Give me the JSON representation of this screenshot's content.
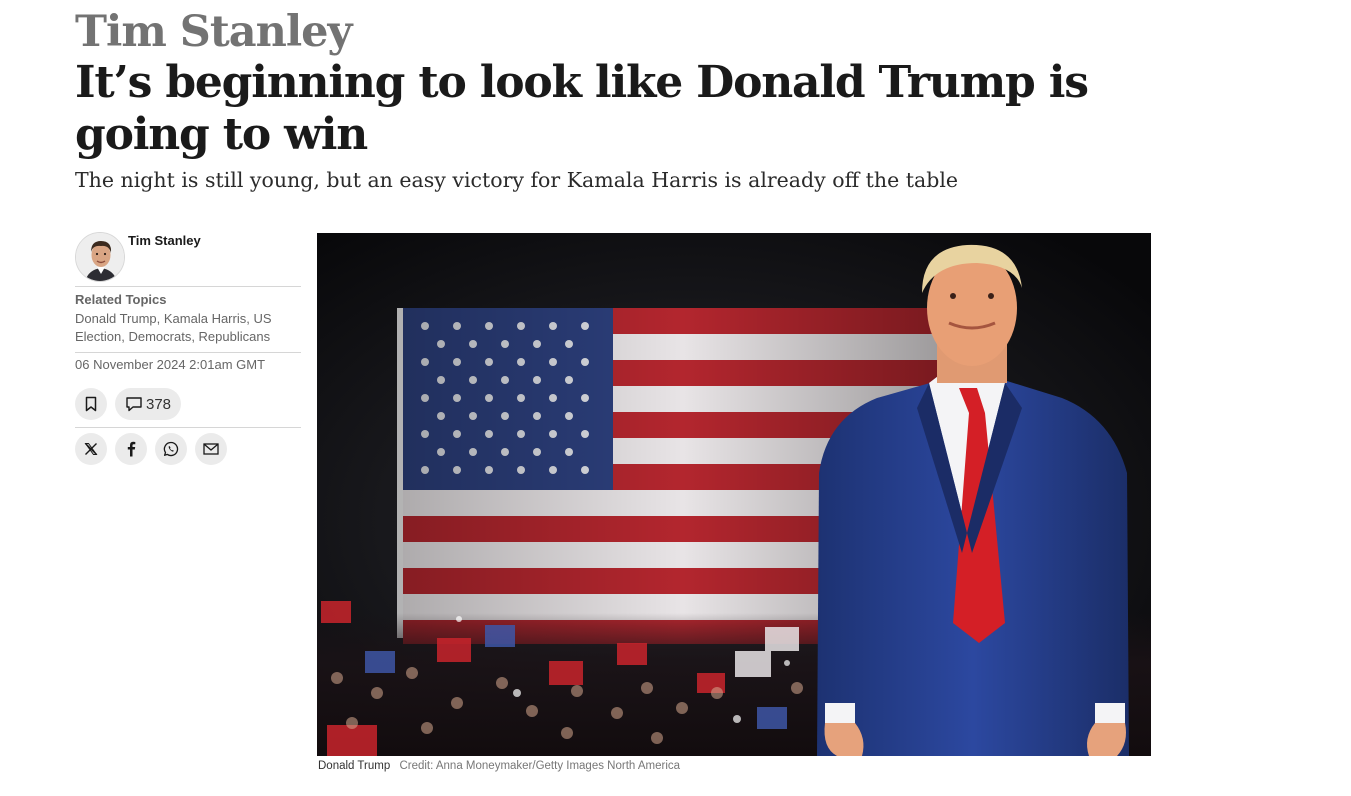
{
  "article": {
    "kicker": "Tim Stanley",
    "headline": "It’s beginning to look like Donald Trump is going to win",
    "standfirst": "The night is still young, but an easy victory for Kamala Harris is already off the table"
  },
  "sidebar": {
    "author_name": "Tim Stanley",
    "topics_title": "Related Topics",
    "topics_text": "Donald Trump, Kamala Harris, US Election, Democrats, Republicans",
    "date": "06 November 2024 2:01am GMT",
    "comments_count": "378",
    "icons": [
      "bookmark-icon",
      "comment-icon",
      "x-icon",
      "facebook-icon",
      "whatsapp-icon",
      "email-icon"
    ]
  },
  "image": {
    "caption": "Donald Trump",
    "credit": "Credit: Anna Moneymaker/Getty Images North America"
  },
  "colors": {
    "kicker": "#737373",
    "flag_red": "#b3262e",
    "flag_blue": "#2c3f7c",
    "suit": "#27408f",
    "tie": "#d41f26"
  }
}
